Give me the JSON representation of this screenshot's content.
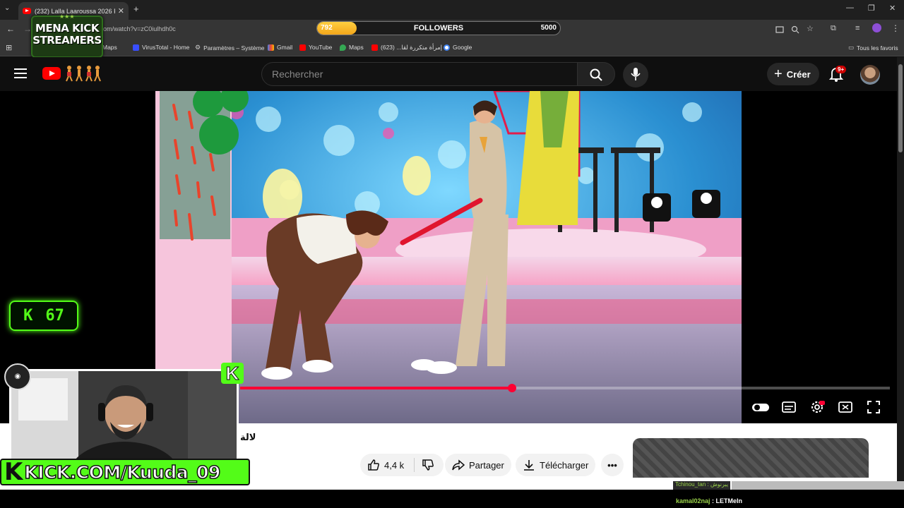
{
  "browser": {
    "tab_title": "(232) Lalla Laaroussa 2026 Prim",
    "url": "om/watch?v=zC0iulhdh0c",
    "bookmarks": [
      "Maps",
      "VirusTotal - Home",
      "Paramètres – Système",
      "Gmail",
      "YouTube",
      "Maps",
      "إمرأة متكررة لقا... (623)",
      "Google"
    ],
    "all_bookmarks": "Tous les favoris"
  },
  "followers_goal": {
    "current": "792",
    "label": "FOLLOWERS",
    "goal": "5000",
    "fraction": 0.158
  },
  "mena_logo": {
    "line1": "MENA KICK",
    "line2": "STREAMERS"
  },
  "youtube": {
    "search_placeholder": "Rechercher",
    "create_label": "Créer",
    "notif_badge": "9+",
    "video_title": "لالة",
    "likes": "4,4 k",
    "share_label": "Partager",
    "download_label": "Télécharger",
    "progress_fraction": 0.419
  },
  "overlay": {
    "kick_count": "67",
    "kick_url": "KICK.COM/Kuuda_09"
  },
  "chat": {
    "line1": "Tchinou_tan : يبرنوش",
    "line2_user": "kamal02naj",
    "line2_msg": " : LETMeIn"
  },
  "colors": {
    "kick_green": "#53fc18",
    "yt_red": "#ff0033",
    "followers_fill": "#f3a61a"
  }
}
